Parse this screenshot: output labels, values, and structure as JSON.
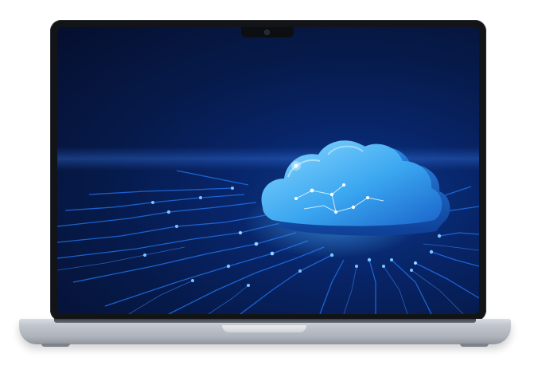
{
  "scene": {
    "subject": "laptop",
    "screen_graphic": "cloud-icon",
    "background_color": "#ffffff",
    "screen_colors": {
      "deep_blue": "#061a4a",
      "glow_blue": "#2f8cff",
      "cloud_light": "#7fd3ff",
      "cloud_dark": "#1f7fe0"
    }
  }
}
